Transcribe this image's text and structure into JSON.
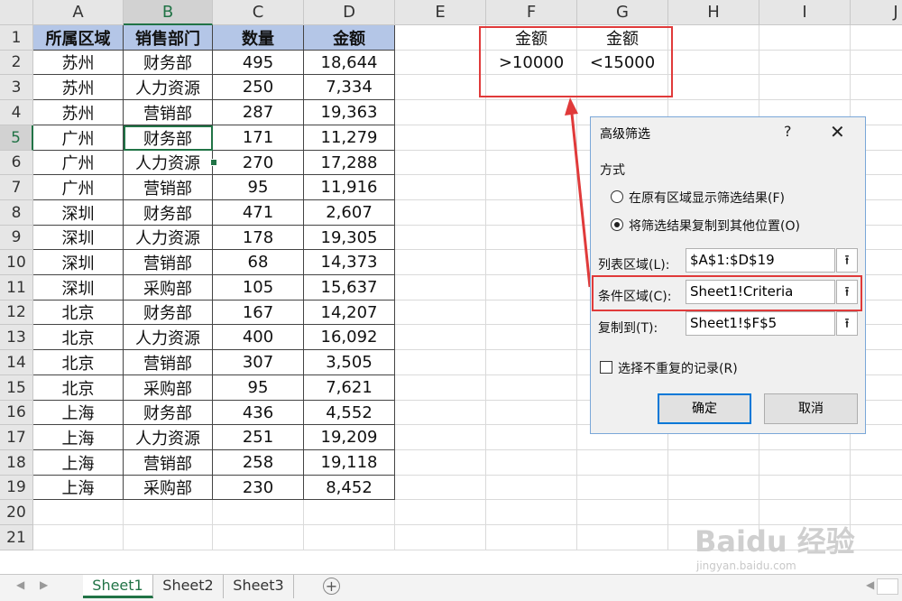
{
  "columns": [
    "A",
    "B",
    "C",
    "D",
    "E",
    "F",
    "G",
    "H",
    "I",
    "J"
  ],
  "rows": [
    "1",
    "2",
    "3",
    "4",
    "5",
    "6",
    "7",
    "8",
    "9",
    "10",
    "11",
    "12",
    "13",
    "14",
    "15",
    "16",
    "17",
    "18",
    "19",
    "20",
    "21"
  ],
  "table": {
    "headers": [
      "所属区域",
      "销售部门",
      "数量",
      "金额"
    ],
    "data": [
      [
        "苏州",
        "财务部",
        "495",
        "18,644"
      ],
      [
        "苏州",
        "人力资源",
        "250",
        "7,334"
      ],
      [
        "苏州",
        "营销部",
        "287",
        "19,363"
      ],
      [
        "广州",
        "财务部",
        "171",
        "11,279"
      ],
      [
        "广州",
        "人力资源",
        "270",
        "17,288"
      ],
      [
        "广州",
        "营销部",
        "95",
        "11,916"
      ],
      [
        "深圳",
        "财务部",
        "471",
        "2,607"
      ],
      [
        "深圳",
        "人力资源",
        "178",
        "19,305"
      ],
      [
        "深圳",
        "营销部",
        "68",
        "14,373"
      ],
      [
        "深圳",
        "采购部",
        "105",
        "15,637"
      ],
      [
        "北京",
        "财务部",
        "167",
        "14,207"
      ],
      [
        "北京",
        "人力资源",
        "400",
        "16,092"
      ],
      [
        "北京",
        "营销部",
        "307",
        "3,505"
      ],
      [
        "北京",
        "采购部",
        "95",
        "7,621"
      ],
      [
        "上海",
        "财务部",
        "436",
        "4,552"
      ],
      [
        "上海",
        "人力资源",
        "251",
        "19,209"
      ],
      [
        "上海",
        "营销部",
        "258",
        "19,118"
      ],
      [
        "上海",
        "采购部",
        "230",
        "8,452"
      ]
    ]
  },
  "criteria": {
    "f1": "金额",
    "g1": "金额",
    "f2": ">10000",
    "g2": "<15000"
  },
  "dialog": {
    "title": "高级筛选",
    "help": "?",
    "close": "✕",
    "mode_label": "方式",
    "option_inplace": "在原有区域显示筛选结果(F)",
    "option_copy": "将筛选结果复制到其他位置(O)",
    "list_range_label": "列表区域(L):",
    "list_range_value": "$A$1:$D$19",
    "criteria_range_label": "条件区域(C):",
    "criteria_range_value": "Sheet1!Criteria",
    "copy_to_label": "复制到(T):",
    "copy_to_value": "Sheet1!$F$5",
    "unique_label": "选择不重复的记录(R)",
    "ok": "确定",
    "cancel": "取消",
    "pick_icon": "⭱"
  },
  "sheets": [
    "Sheet1",
    "Sheet2",
    "Sheet3"
  ],
  "add_sheet": "+",
  "watermark": "Baidu 经验",
  "watermark_url": "jingyan.baidu.com",
  "colors": {
    "header_fill": "#b4c6e7",
    "excel_green": "#217346",
    "highlight_red": "#e03a3a"
  }
}
